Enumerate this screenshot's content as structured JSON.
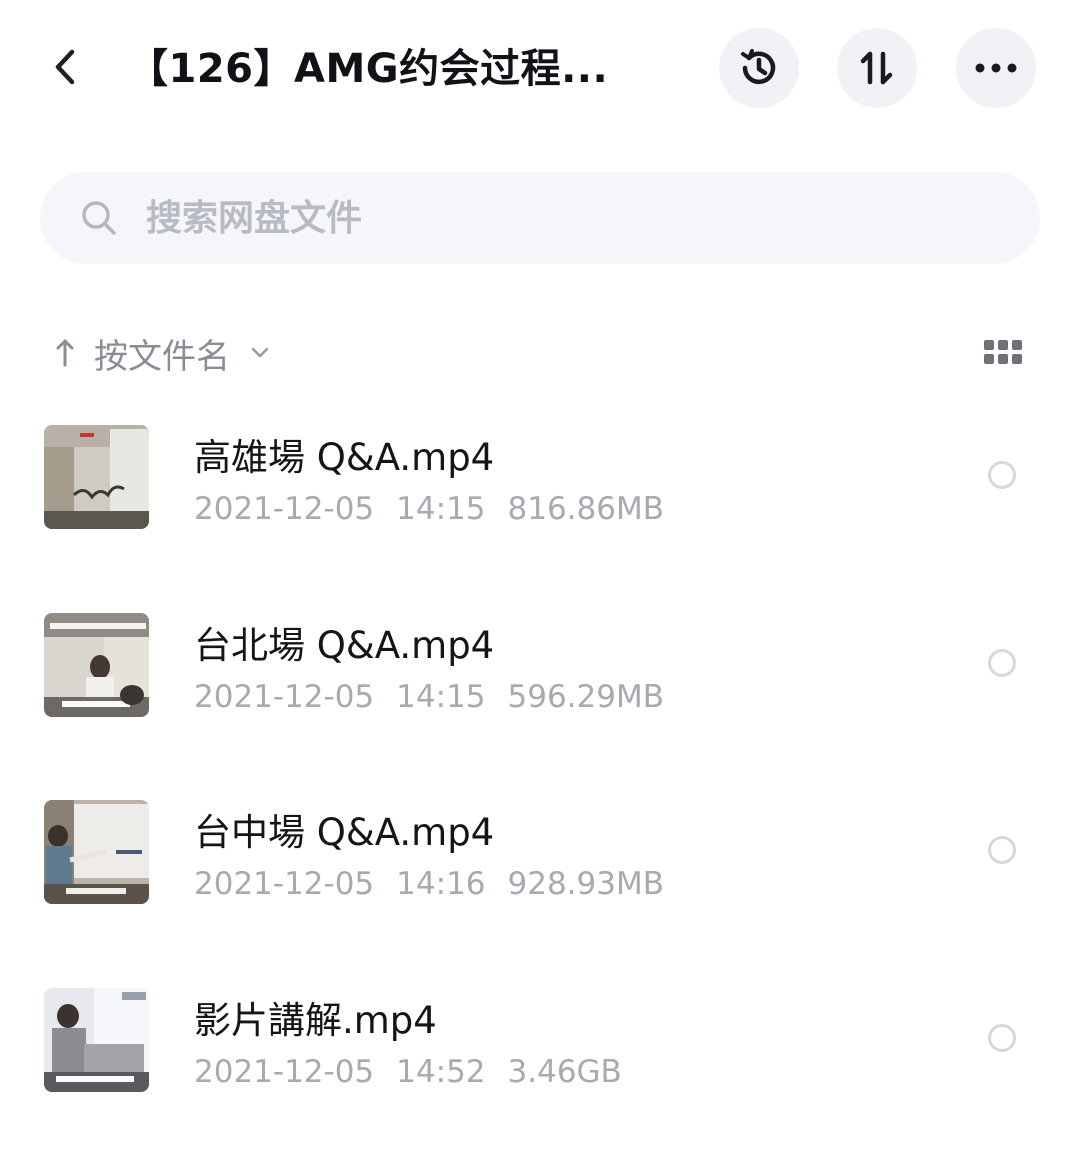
{
  "header": {
    "title": "【126】AMG约会过程...",
    "back_icon": "chevron-left-icon",
    "history_icon": "history-icon",
    "sort_icon": "sort-toggle-icon",
    "more_icon": "more-horizontal-icon"
  },
  "search": {
    "placeholder": "搜索网盘文件",
    "icon": "search-icon"
  },
  "sort": {
    "direction_icon": "arrow-up-icon",
    "label": "按文件名",
    "chevron_icon": "chevron-down-icon",
    "view_icon": "grid-view-icon"
  },
  "files": [
    {
      "name": "高雄場 Q&A.mp4",
      "date": "2021-12-05",
      "time": "14:15",
      "size": "816.86MB"
    },
    {
      "name": "台北場 Q&A.mp4",
      "date": "2021-12-05",
      "time": "14:15",
      "size": "596.29MB"
    },
    {
      "name": "台中場 Q&A.mp4",
      "date": "2021-12-05",
      "time": "14:16",
      "size": "928.93MB"
    },
    {
      "name": "影片講解.mp4",
      "date": "2021-12-05",
      "time": "14:52",
      "size": "3.46GB"
    }
  ],
  "colors": {
    "text_primary": "#141519",
    "text_secondary": "#a7aab1",
    "button_bg": "#f1f2f5",
    "search_bg": "#f5f6f9"
  }
}
